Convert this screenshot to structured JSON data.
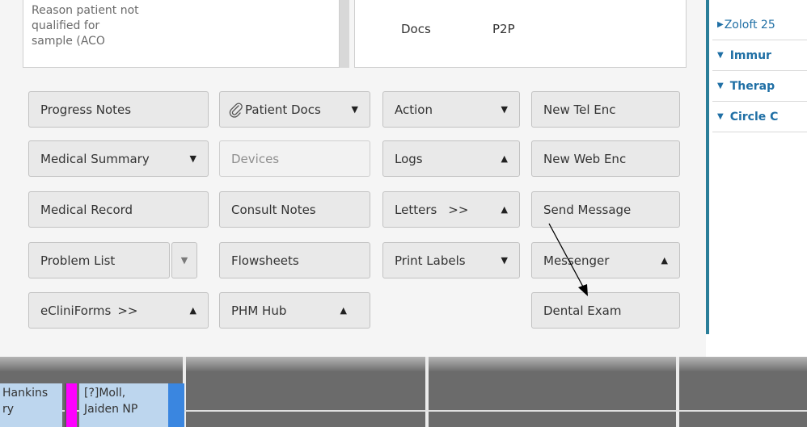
{
  "reason_box": {
    "lines": [
      "Reason patient not",
      "qualified for",
      "sample (ACO"
    ]
  },
  "docs_box": {
    "docs_label": "Docs",
    "p2p_label": "P2P"
  },
  "buttons": {
    "progress_notes": "Progress Notes",
    "patient_docs": "Patient Docs",
    "action": "Action",
    "new_tel_enc": "New Tel Enc",
    "medical_summary": "Medical Summary",
    "devices": "Devices",
    "logs": "Logs",
    "new_web_enc": "New Web Enc",
    "medical_record": "Medical Record",
    "consult_notes": "Consult Notes",
    "letters": "Letters",
    "letters_more": ">>",
    "send_message": "Send Message",
    "problem_list": "Problem List",
    "flowsheets": "Flowsheets",
    "print_labels": "Print Labels",
    "messenger": "Messenger",
    "ecliniforms": "eCliniForms",
    "ecliniforms_more": ">>",
    "phm_hub": "PHM Hub",
    "dental_exam": "Dental Exam"
  },
  "right_panel": {
    "items": [
      {
        "label": "Zoloft 25"
      },
      {
        "label": "Immur"
      },
      {
        "label": "Therap"
      },
      {
        "label": "Circle C"
      }
    ]
  },
  "schedule": {
    "appt1": [
      "Hankins",
      "ry"
    ],
    "appt2": [
      "[?]Moll,",
      "Jaiden NP"
    ]
  },
  "colors": {
    "accent_border": "#2a7e99",
    "link_blue": "#1f6fa5",
    "appointment_bg": "#bdd6ee",
    "magenta_marker": "#ff00ff"
  }
}
